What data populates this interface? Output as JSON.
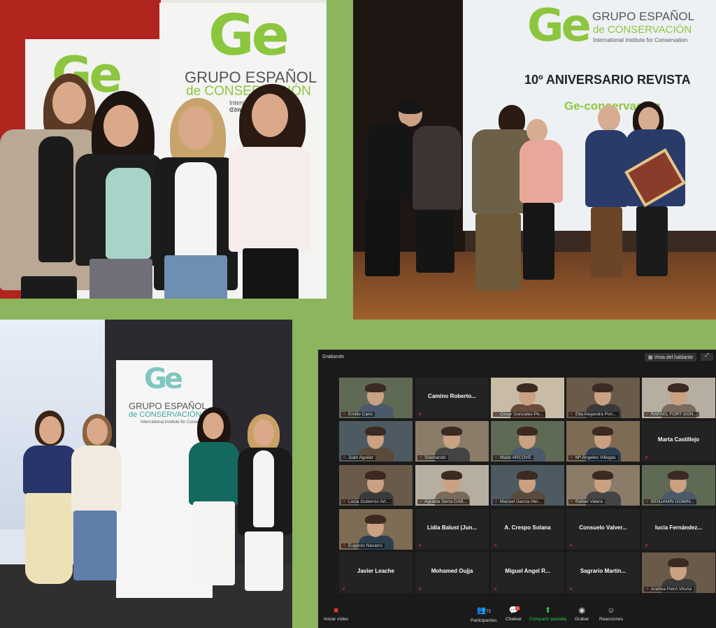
{
  "banner": {
    "logo": "Ge",
    "line1": "GRUPO ESPAÑOL",
    "line2": "de CONSERVACIÓN",
    "line3": "International Institute for Conservation",
    "line4": "of historic and artistic works"
  },
  "stage": {
    "title": "10º ANIVERSARIO REVISTA",
    "subtitle": "Ge-conservación"
  },
  "zoom": {
    "recording": "Grabando",
    "speaker_view": "Vista del hablante",
    "participant_count": "72",
    "chat_badge": "1",
    "tiles": [
      {
        "name": "Emilio Cano",
        "video": true
      },
      {
        "name": "Camino  Roberto...",
        "video": false
      },
      {
        "name": "Cesar Gonzalez-Pe...",
        "video": true
      },
      {
        "name": "Elia Alejandra Pon...",
        "video": true
      },
      {
        "name": "RAFAEL FORT GON...",
        "video": true
      },
      {
        "name": "Juan Aguilar",
        "video": true
      },
      {
        "name": "Sisenando",
        "video": true
      },
      {
        "name": "Maite ARCOVE",
        "video": true
      },
      {
        "name": "Mª Ángeles Villegas",
        "video": true
      },
      {
        "name": "Marta Castillejo",
        "video": false
      },
      {
        "name": "Lucia Gutierrez Art...",
        "video": true
      },
      {
        "name": "Águeda Serra GAB...",
        "video": true
      },
      {
        "name": "Manuel Garcia Her...",
        "video": true
      },
      {
        "name": "Rafael Valera",
        "video": true
      },
      {
        "name": "BENJAMIN DOMIN...",
        "video": true
      },
      {
        "name": "Eugenio Navarro",
        "video": true
      },
      {
        "name": "Lidia Balust (Jun...",
        "video": false
      },
      {
        "name": "A. Crespo Solana",
        "video": false
      },
      {
        "name": "Consuelo  Valver...",
        "video": false
      },
      {
        "name": "lucia  Fernández...",
        "video": false
      },
      {
        "name": "Javier Leache",
        "video": false
      },
      {
        "name": "Mohamed Oujja",
        "video": false
      },
      {
        "name": "Miguel Angel R...",
        "video": false
      },
      {
        "name": "Sagrario  Martín...",
        "video": false
      },
      {
        "name": "Andrea Peiró Vitoria",
        "video": true
      }
    ],
    "toolbar": {
      "start_video": "Iniciar vídeo",
      "participants": "Participantes",
      "chat": "Chatear",
      "share": "Compartir pantalla",
      "record": "Grabar",
      "reactions": "Reacciones"
    }
  },
  "colors": {
    "background": "#8cb55e",
    "brand_green": "#8cc63f",
    "zoom_bg": "#1a1a1a"
  }
}
